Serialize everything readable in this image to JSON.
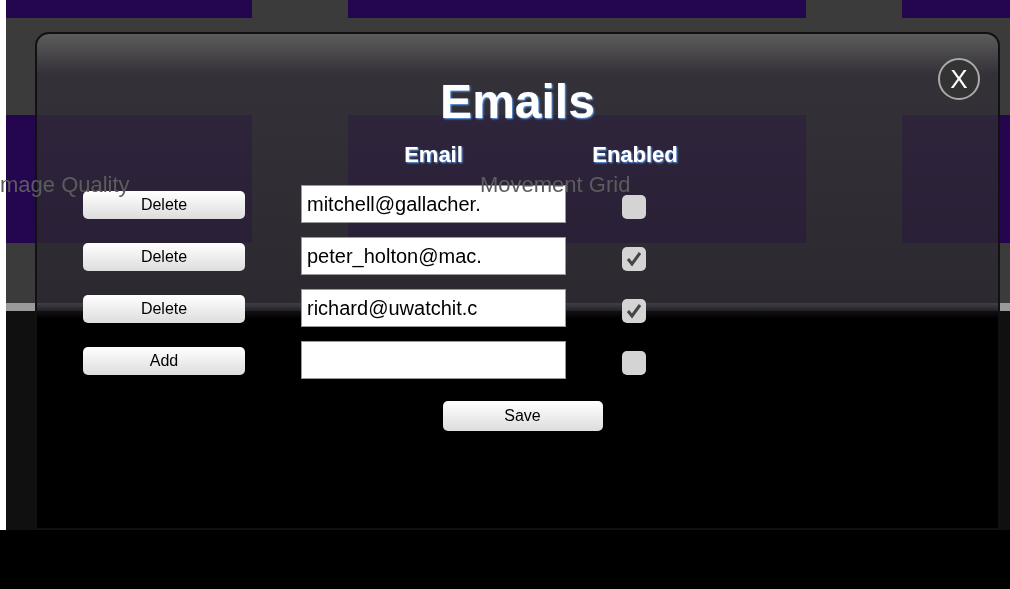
{
  "background_labels": [
    "mage Quality",
    "Movement Grid"
  ],
  "dialog": {
    "title": "Emails",
    "close": "X",
    "columns": [
      "Email",
      "Enabled"
    ],
    "rows": [
      {
        "button": "Delete",
        "email": "mitchell@gallacher.",
        "enabled": false
      },
      {
        "button": "Delete",
        "email": "peter_holton@mac.",
        "enabled": true
      },
      {
        "button": "Delete",
        "email": "richard@uwatchit.c",
        "enabled": true
      },
      {
        "button": "Add",
        "enabled": false
      }
    ],
    "save": "Save"
  }
}
